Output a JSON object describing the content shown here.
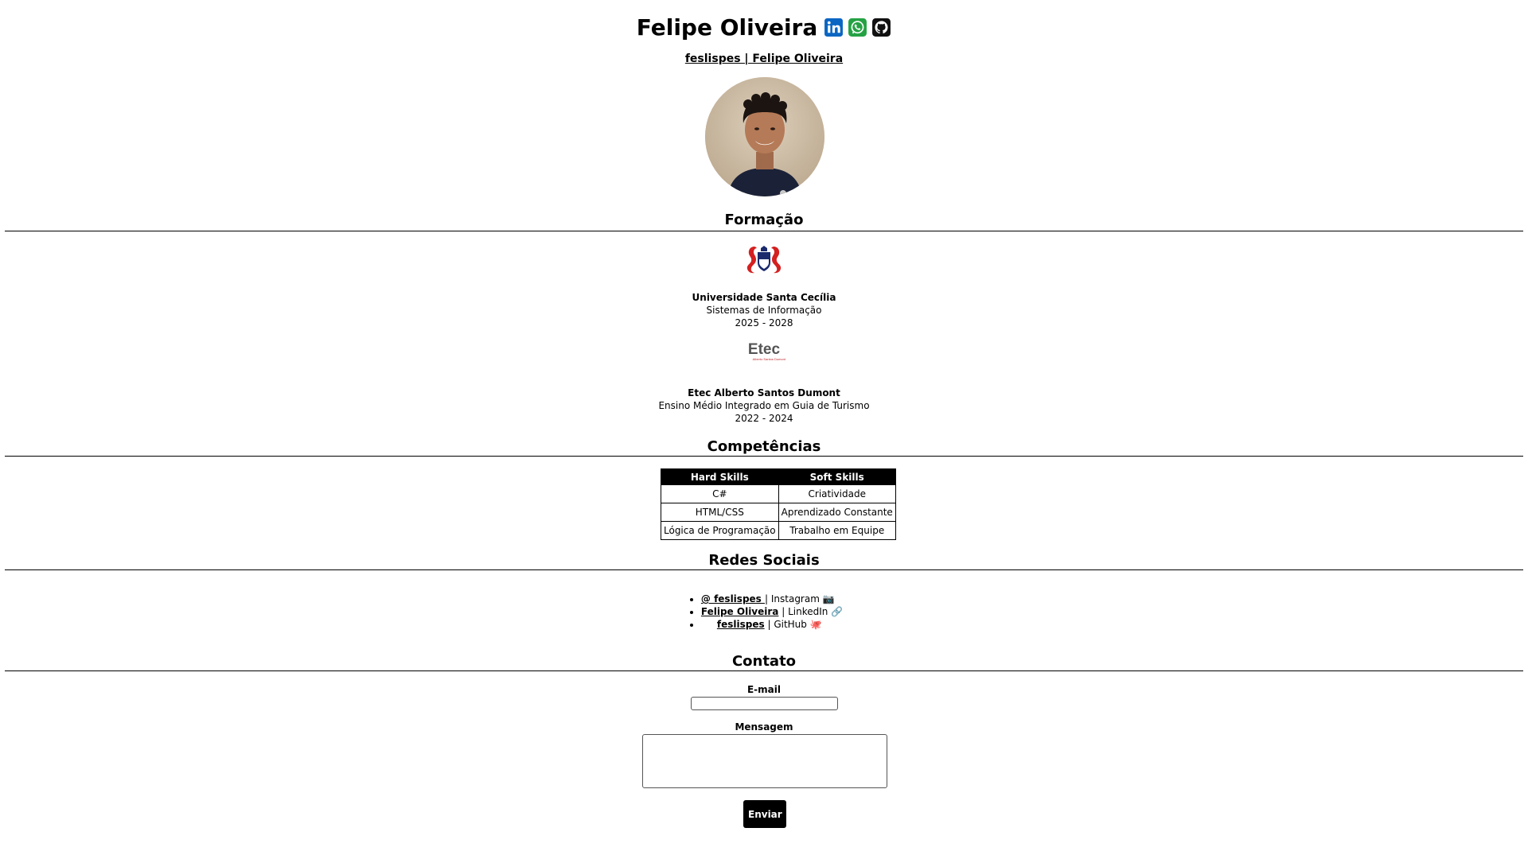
{
  "header": {
    "title": "Felipe Oliveira",
    "icons": [
      "linkedin-icon",
      "whatsapp-icon",
      "github-icon"
    ],
    "subtitle_link": "feslispes | Felipe Oliveira",
    "colors": {
      "linkedin": "#0a66c2",
      "whatsapp": "#25a244",
      "github": "#000000"
    }
  },
  "education": {
    "heading": "Formação",
    "items": [
      {
        "institution": "Universidade Santa Cecília",
        "course": "Sistemas de Informação",
        "period": "2025 - 2028",
        "logo_icon": "santa-cecilia-logo"
      },
      {
        "institution": "Etec Alberto Santos Dumont",
        "course": "Ensino Médio Integrado em Guia de Turismo",
        "period": "2022 - 2024",
        "logo_icon": "etec-logo",
        "logo_text": "Etec",
        "logo_sub": "Alberto Santos Dumont"
      }
    ]
  },
  "skills": {
    "heading": "Competências",
    "columns": [
      "Hard Skills",
      "Soft Skills"
    ],
    "rows": [
      [
        "C#",
        "Criatividade"
      ],
      [
        "HTML/CSS",
        "Aprendizado Constante"
      ],
      [
        "Lógica de Programação",
        "Trabalho em Equipe"
      ]
    ]
  },
  "socials": {
    "heading": "Redes Sociais",
    "items": [
      {
        "link": "@ feslispes ",
        "rest": " | Instagram 📷"
      },
      {
        "link": "Felipe Oliveira",
        "rest": " | LinkedIn 🔗"
      },
      {
        "link": "feslispes",
        "rest": " | GitHub 🐙"
      }
    ]
  },
  "contact": {
    "heading": "Contato",
    "email_label": "E-mail",
    "email_value": "",
    "message_label": "Mensagem",
    "message_value": "",
    "submit_label": "Enviar"
  }
}
